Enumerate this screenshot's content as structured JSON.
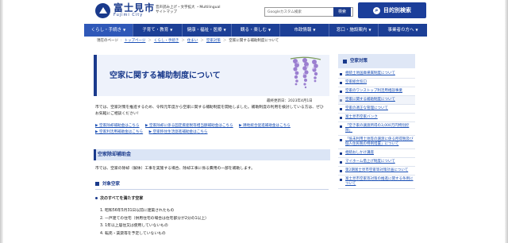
{
  "header": {
    "logo_jp": "富士見市",
    "logo_en": "Fujimi City",
    "util_line1": "音声読み上げ・文字拡大 ・Multilingual",
    "util_line2": "サイトマップ",
    "search_placeholder": "Googleカスタム検索",
    "search_button": "検索",
    "purpose_button": "目的別検索"
  },
  "nav": [
    {
      "label": "くらし・手続き",
      "active": true
    },
    {
      "label": "子育て・教育",
      "active": false
    },
    {
      "label": "健康・福祉・医療",
      "active": false
    },
    {
      "label": "観る・楽しむ",
      "active": false
    },
    {
      "label": "市政情報",
      "active": false
    },
    {
      "label": "窓口・施設案内",
      "active": false
    },
    {
      "label": "事業者の方へ",
      "active": false
    }
  ],
  "breadcrumb": {
    "prefix": "現在のページ",
    "items": [
      "トップページ",
      "くらし・手続き",
      "住まい",
      "空家対策"
    ],
    "current": "空家に関する補助制度について"
  },
  "main": {
    "title": "空家に関する補助制度について",
    "updated": "最終更新日：2023年4月1日",
    "intro": "市では、空家対策を推進するため、令和元年度から空家に関する補助制度を開始しました。補助制度の利用を検討している方は、ぜひお気軽にご相談ください！",
    "links": [
      "空家除却補助金はこちら",
      "空家除却に係る固定資産税等相当額補助金はこちら",
      "隣地統合促進補助金はこちら",
      "空家利活用補助金はこちら",
      "空家移住生活促進補助金はこちら"
    ],
    "section_title": "空家除却補助金",
    "section_text": "市では、空家の除却（解体）工事を実施する場合、除却工事に係る費用の一部を補助します。",
    "subsection_title": "対象空家",
    "condition_title": "次のすべてを満たす空家",
    "conditions": [
      "1. 昭和56年5月31日以前に建築されたもの",
      "2. 一戸建ての住宅（併用住宅の場合は住宅部分が2分の1以上）",
      "3. 1年以上居住又は使用していないもの",
      "4. 転売・賃貸等を予定していないもの"
    ]
  },
  "sidebar": {
    "title": "空家対策",
    "items": [
      "相続土地国庫帰属制度について",
      "空家総合窓口",
      "空家のワンストップ利活用相談事業",
      "空家に関する補助制度について",
      "空家の適正な管理について",
      "富士見市空家バンク",
      "「空き家の譲渡所得の3,000万円特別控除」",
      "「低未利用土地等の譲渡に係る所得税及び個人住民税の特例措置」について",
      "相続おしかけ講座",
      "マイホーム借上げ制度について",
      "第2期富士見市空家等対策計画について",
      "富士見市空家等対策の推進に関する条例について"
    ],
    "current_index": 3
  },
  "colors": {
    "brand": "#1a3a8c",
    "nav": "#1c3f96",
    "link": "#1a4fb5",
    "wisteria": "#9b7fd0"
  }
}
